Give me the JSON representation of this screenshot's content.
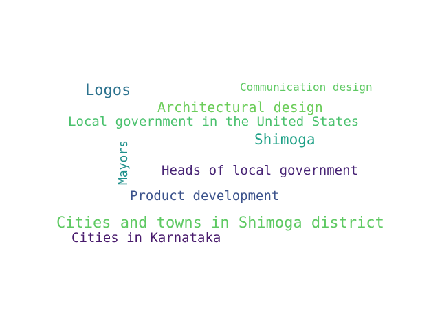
{
  "words": [
    {
      "text": "Communication design",
      "color": "#5ec962"
    },
    {
      "text": "Logos",
      "color": "#2c728e"
    },
    {
      "text": "Architectural design",
      "color": "#6ccd5a"
    },
    {
      "text": "Local government in the United States",
      "color": "#4ac16d"
    },
    {
      "text": "Shimoga",
      "color": "#1fa187"
    },
    {
      "text": "Mayors",
      "color": "#21918c"
    },
    {
      "text": "Heads of local government",
      "color": "#482475"
    },
    {
      "text": "Product development",
      "color": "#3b528b"
    },
    {
      "text": "Cities and towns in Shimoga district",
      "color": "#5ec962"
    },
    {
      "text": "Cities in Karnataka",
      "color": "#481a6c"
    }
  ]
}
